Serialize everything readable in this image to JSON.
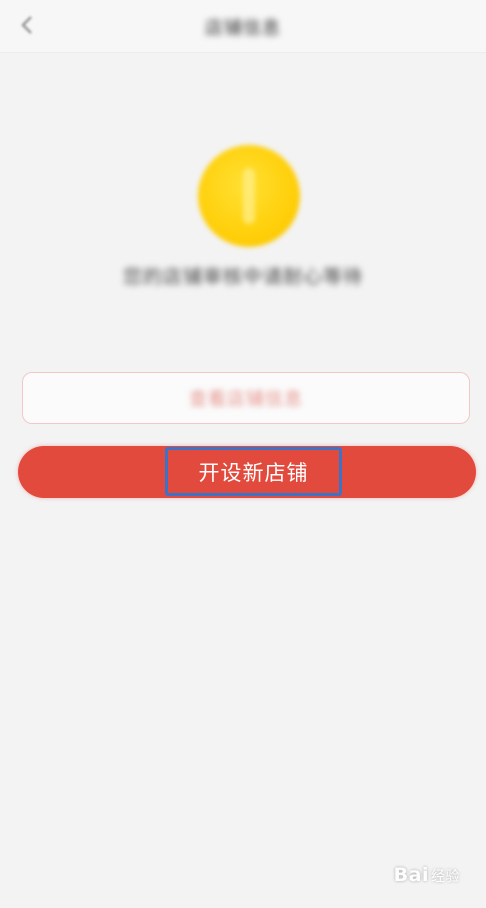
{
  "header": {
    "back_icon": "chevron-left-icon",
    "title": "店铺信息"
  },
  "status": {
    "icon": "coin-icon",
    "message": "您的店铺审核中请耐心等待"
  },
  "buttons": {
    "secondary_label": "查看店铺信息",
    "primary_label": "开设新店铺"
  },
  "watermark": {
    "text": "Bai",
    "suffix": "经验"
  },
  "colors": {
    "background": "#f3f3f3",
    "primary": "#e24a3d",
    "highlight": "#3b73c9",
    "coin": "#ffcf0a"
  }
}
